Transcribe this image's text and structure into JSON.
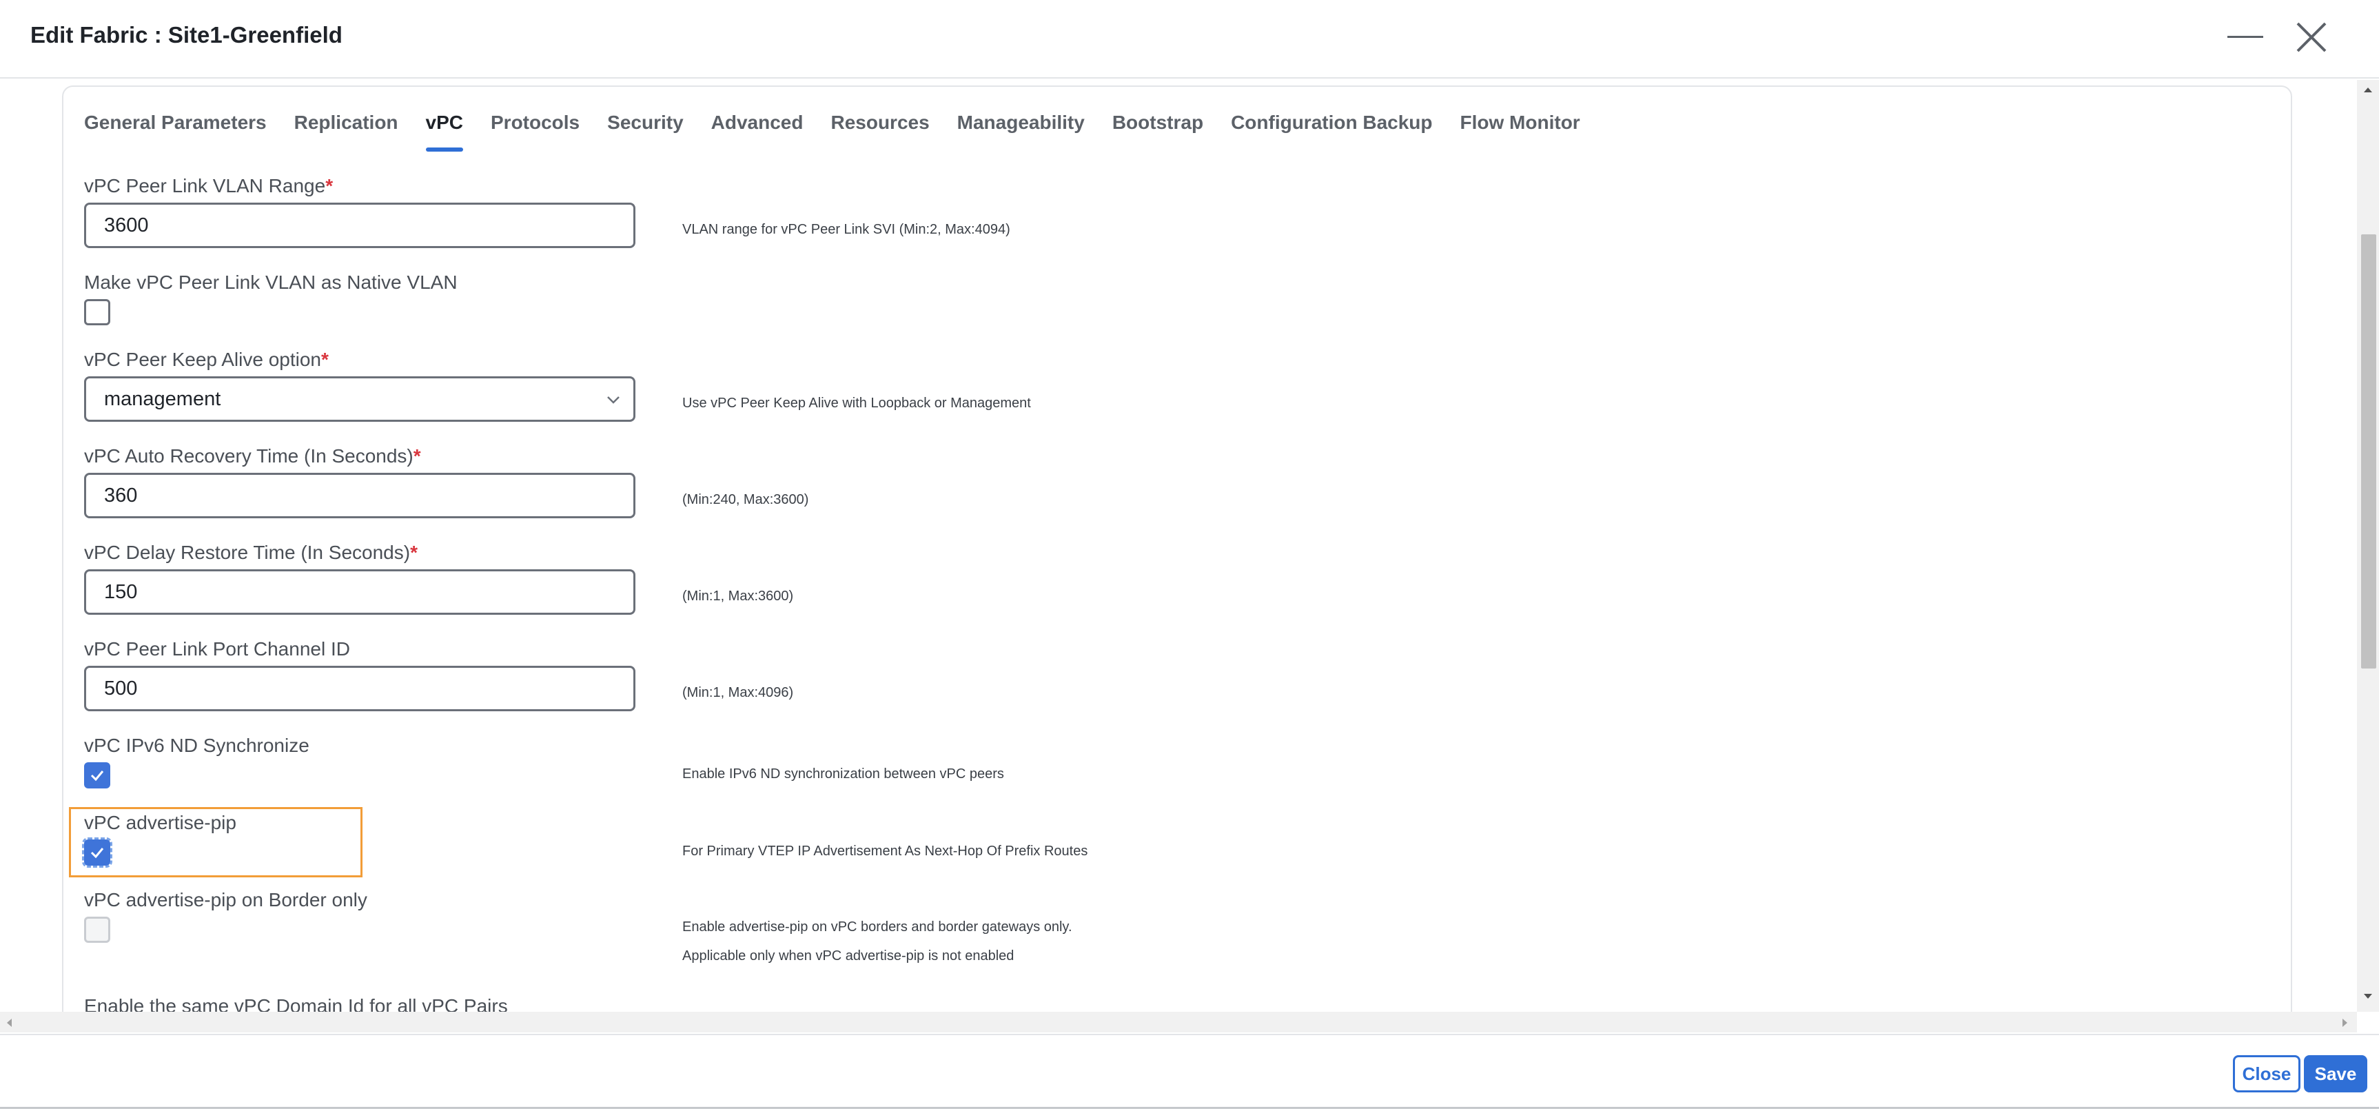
{
  "header": {
    "title": "Edit Fabric : Site1-Greenfield"
  },
  "tabs": [
    {
      "label": "General Parameters"
    },
    {
      "label": "Replication"
    },
    {
      "label": "vPC",
      "active": true
    },
    {
      "label": "Protocols"
    },
    {
      "label": "Security"
    },
    {
      "label": "Advanced"
    },
    {
      "label": "Resources"
    },
    {
      "label": "Manageability"
    },
    {
      "label": "Bootstrap"
    },
    {
      "label": "Configuration Backup"
    },
    {
      "label": "Flow Monitor"
    }
  ],
  "form": {
    "peer_link_vlan": {
      "label": "vPC Peer Link VLAN Range",
      "required": "*",
      "value": "3600",
      "help": "VLAN range for vPC Peer Link SVI (Min:2, Max:4094)"
    },
    "native_vlan": {
      "label": "Make vPC Peer Link VLAN as Native VLAN",
      "checked": false
    },
    "keep_alive": {
      "label": "vPC Peer Keep Alive option",
      "required": "*",
      "value": "management",
      "help": "Use vPC Peer Keep Alive with Loopback or Management"
    },
    "auto_recovery": {
      "label": "vPC Auto Recovery Time (In Seconds)",
      "required": "*",
      "value": "360",
      "help": "(Min:240, Max:3600)"
    },
    "delay_restore": {
      "label": "vPC Delay Restore Time (In Seconds)",
      "required": "*",
      "value": "150",
      "help": "(Min:1, Max:3600)"
    },
    "port_channel": {
      "label": "vPC Peer Link Port Channel ID",
      "value": "500",
      "help": "(Min:1, Max:4096)"
    },
    "ipv6_nd": {
      "label": "vPC IPv6 ND Synchronize",
      "checked": true,
      "help": "Enable IPv6 ND synchronization between vPC peers"
    },
    "advertise_pip": {
      "label": "vPC advertise-pip",
      "checked": true,
      "help": "For Primary VTEP IP Advertisement As Next-Hop Of Prefix Routes"
    },
    "advertise_pip_border": {
      "label": "vPC advertise-pip on Border only",
      "checked": false,
      "disabled": true,
      "help_line1": "Enable advertise-pip on vPC borders and border gateways only.",
      "help_line2": "Applicable only when vPC advertise-pip is not enabled"
    },
    "same_domain_id": {
      "label": "Enable the same vPC Domain Id for all vPC Pairs"
    }
  },
  "footer": {
    "close_label": "Close",
    "save_label": "Save"
  },
  "colors": {
    "accent": "#2f6fd6",
    "required": "#d9363e",
    "highlight": "#f29d38"
  }
}
